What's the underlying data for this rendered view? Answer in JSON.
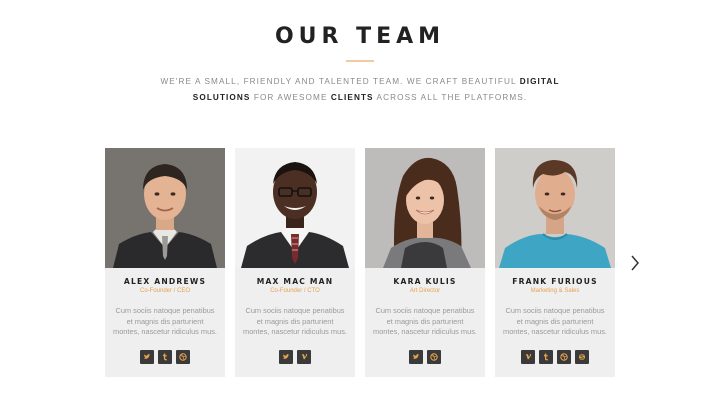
{
  "header": {
    "title": "OUR TEAM",
    "subtitle_part1": "WE'RE A SMALL, FRIENDLY AND TALENTED TEAM. WE CRAFT BEAUTIFUL ",
    "subtitle_bold1": "DIGITAL SOLUTIONS",
    "subtitle_part2": " FOR AWESOME ",
    "subtitle_bold2": "CLIENTS",
    "subtitle_part3": " ACROSS ALL THE PLATFORMS."
  },
  "members": [
    {
      "name": "ALEX ANDREWS",
      "role": "Co-Founder / CEO",
      "bio": "Cum sociis natoque penatibus et magnis dis parturient montes, nascetur ridiculus mus.",
      "socials": [
        "twitter-icon",
        "tumblr-icon",
        "dribbble-icon"
      ]
    },
    {
      "name": "MAX MAC MAN",
      "role": "Co-Founder / CTO",
      "bio": "Cum sociis natoque penatibus et magnis dis parturient montes, nascetur ridiculus mus.",
      "socials": [
        "twitter-icon",
        "vimeo-icon"
      ]
    },
    {
      "name": "KARA KULIS",
      "role": "Art Director",
      "bio": "Cum sociis natoque penatibus et magnis dis parturient montes, nascetur ridiculus mus.",
      "socials": [
        "twitter-icon",
        "dribbble-icon"
      ]
    },
    {
      "name": "FRANK FURIOUS",
      "role": "Marketing & Sales",
      "bio": "Cum sociis natoque penatibus et magnis dis parturient montes, nascetur ridiculus mus.",
      "socials": [
        "vimeo-icon",
        "tumblr-icon",
        "dribbble-icon",
        "skype-icon"
      ]
    }
  ],
  "colors": {
    "accent": "#e8a24d",
    "card_bg": "#efefef",
    "social_bg": "#3a3a3a",
    "title": "#222222"
  },
  "carousel": {
    "next_icon": "chevron-right-icon"
  }
}
